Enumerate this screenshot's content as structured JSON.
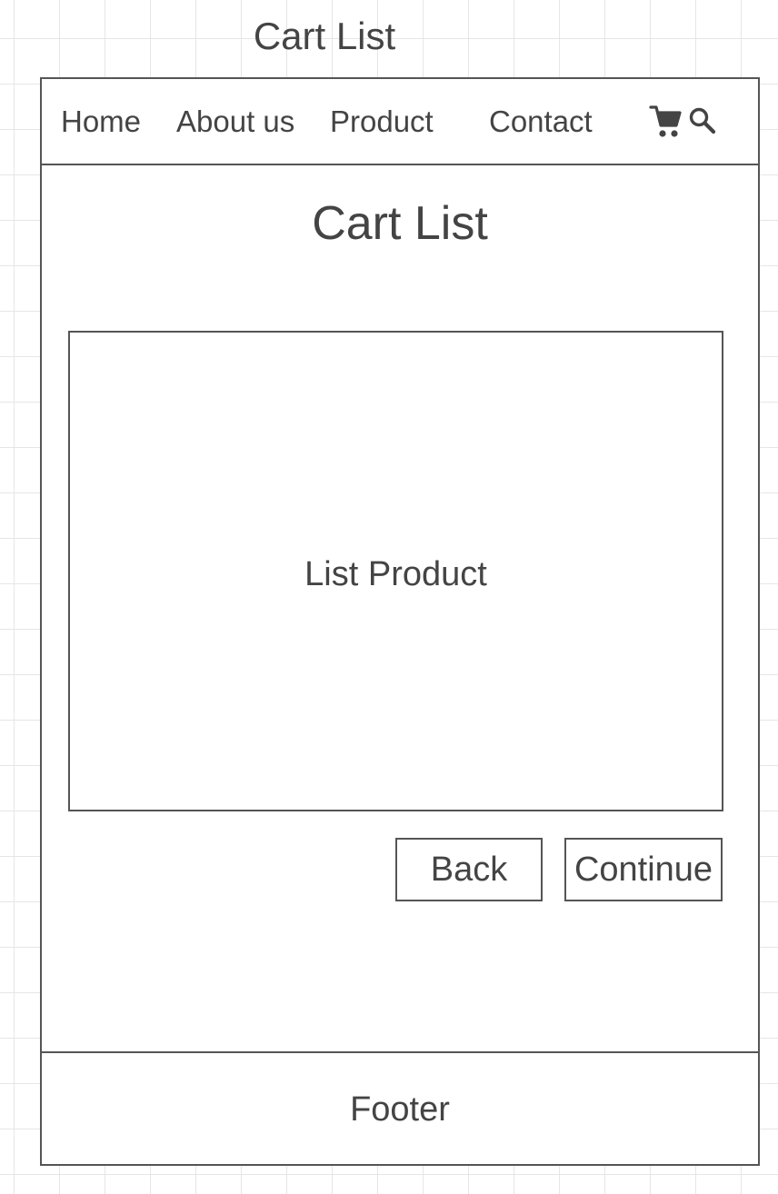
{
  "page_label": "Cart List",
  "nav": {
    "items": [
      {
        "label": "Home"
      },
      {
        "label": "About us"
      },
      {
        "label": "Product"
      },
      {
        "label": "Contact"
      }
    ],
    "cart_icon": "cart-icon",
    "search_icon": "search-icon"
  },
  "main": {
    "title": "Cart List",
    "list_placeholder": "List Product",
    "back_label": "Back",
    "continue_label": "Continue"
  },
  "footer": {
    "label": "Footer"
  },
  "colors": {
    "stroke": "#555555",
    "text": "#444444",
    "grid": "#e6e6e6"
  }
}
